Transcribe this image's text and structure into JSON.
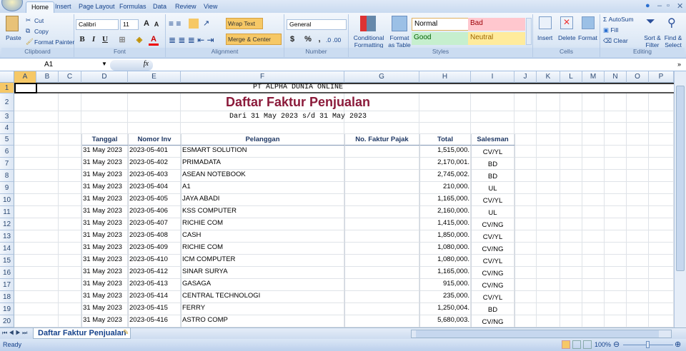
{
  "ribbon": {
    "tabs": [
      "Home",
      "Insert",
      "Page Layout",
      "Formulas",
      "Data",
      "Review",
      "View"
    ],
    "clipboard": {
      "paste": "Paste",
      "cut": "Cut",
      "copy": "Copy",
      "format_painter": "Format Painter",
      "label": "Clipboard"
    },
    "font": {
      "name": "Calibri",
      "size": "11",
      "bold": "B",
      "italic": "I",
      "underline": "U",
      "label": "Font"
    },
    "alignment": {
      "wrap_text": "Wrap Text",
      "merge_center": "Merge & Center",
      "label": "Alignment"
    },
    "number": {
      "format": "General",
      "currency": "$",
      "percent": "%",
      "comma": ",",
      "label": "Number"
    },
    "styles": {
      "conditional": "Conditional Formatting",
      "format_table": "Format as Table",
      "normal": "Normal",
      "bad": "Bad",
      "good": "Good",
      "neutral": "Neutral",
      "label": "Styles"
    },
    "cells": {
      "insert": "Insert",
      "delete": "Delete",
      "format": "Format",
      "label": "Cells"
    },
    "editing": {
      "autosum": "AutoSum",
      "fill": "Fill",
      "clear": "Clear",
      "sort": "Sort & Filter",
      "find": "Find & Select",
      "label": "Editing"
    }
  },
  "formula_bar": {
    "name_box": "A1",
    "fx": "fx",
    "value": ""
  },
  "columns": [
    "A",
    "B",
    "C",
    "D",
    "E",
    "F",
    "G",
    "H",
    "I",
    "J",
    "K",
    "L",
    "M",
    "N",
    "O",
    "P"
  ],
  "sheet": {
    "company": "PT ALPHA DUNIA ONLINE",
    "title": "Daftar Faktur Penjualan",
    "period": "Dari 31 May 2023 s/d 31 May 2023",
    "headers": [
      "Tanggal",
      "Nomor Inv",
      "Pelanggan",
      "No. Faktur Pajak",
      "Total",
      "Salesman"
    ],
    "rows": [
      [
        "31 May 2023",
        "2023-05-401",
        "ESMART SOLUTION",
        "",
        "1,515,000.",
        "CV/YL"
      ],
      [
        "31 May 2023",
        "2023-05-402",
        "PRIMADATA",
        "",
        "2,170,001.",
        "BD"
      ],
      [
        "31 May 2023",
        "2023-05-403",
        "ASEAN NOTEBOOK",
        "",
        "2,745,002.",
        "BD"
      ],
      [
        "31 May 2023",
        "2023-05-404",
        "A1",
        "",
        "210,000.",
        "UL"
      ],
      [
        "31 May 2023",
        "2023-05-405",
        "JAYA ABADI",
        "",
        "1,165,000.",
        "CV/YL"
      ],
      [
        "31 May 2023",
        "2023-05-406",
        "KSS COMPUTER",
        "",
        "2,160,000.",
        "UL"
      ],
      [
        "31 May 2023",
        "2023-05-407",
        "RICHIE COM",
        "",
        "1,415,000.",
        "CV/NG"
      ],
      [
        "31 May 2023",
        "2023-05-408",
        "CASH",
        "",
        "1,850,000.",
        "CV/YL"
      ],
      [
        "31 May 2023",
        "2023-05-409",
        "RICHIE COM",
        "",
        "1,080,000.",
        "CV/NG"
      ],
      [
        "31 May 2023",
        "2023-05-410",
        "ICM COMPUTER",
        "",
        "1,080,000.",
        "CV/YL"
      ],
      [
        "31 May 2023",
        "2023-05-412",
        "SINAR SURYA",
        "",
        "1,165,000.",
        "CV/NG"
      ],
      [
        "31 May 2023",
        "2023-05-413",
        "GASAGA",
        "",
        "915,000.",
        "CV/NG"
      ],
      [
        "31 May 2023",
        "2023-05-414",
        "CENTRAL TECHNOLOGI",
        "",
        "235,000.",
        "CV/YL"
      ],
      [
        "31 May 2023",
        "2023-05-415",
        "FERRY",
        "",
        "1,250,004.",
        "BD"
      ],
      [
        "31 May 2023",
        "2023-05-416",
        "ASTRO COMP",
        "",
        "5,680,003.",
        "CV/NG"
      ]
    ]
  },
  "sheet_tab": "Daftar Faktur Penjualan",
  "status": {
    "ready": "Ready",
    "zoom": "100%"
  },
  "colors": {
    "title": "#8b1a3a",
    "header": "#1f3864",
    "accent": "#f6c866"
  }
}
